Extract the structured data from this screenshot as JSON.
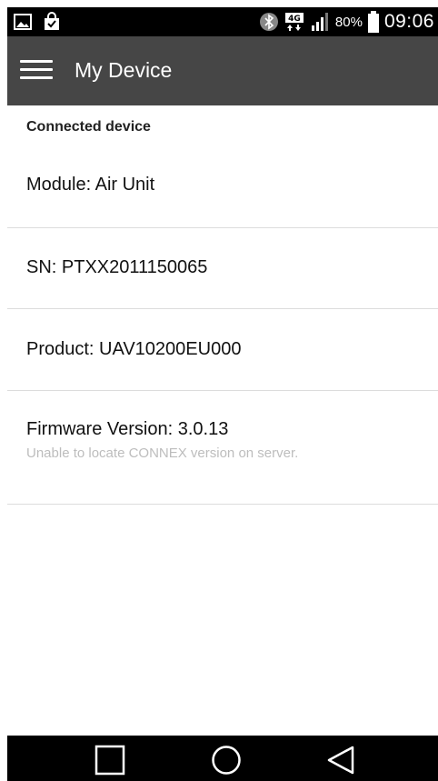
{
  "status_bar": {
    "left_icons": [
      "image-icon",
      "shopping-bag-icon"
    ],
    "right_icons": [
      "bluetooth-icon",
      "network-4g-icon",
      "signal-icon",
      "battery-icon"
    ],
    "network_label": "4G",
    "battery_percent": "80%",
    "time": "09:06"
  },
  "app_bar": {
    "title": "My Device",
    "menu_icon": "hamburger-menu-icon"
  },
  "content": {
    "section_header": "Connected device",
    "rows": [
      {
        "label": "Module: Air Unit"
      },
      {
        "label": "SN: PTXX2011150065"
      },
      {
        "label": "Product: UAV10200EU000"
      },
      {
        "label": "Firmware Version: 3.0.13",
        "subtext": "Unable to locate CONNEX version on server."
      }
    ]
  },
  "nav_bar": {
    "buttons": [
      "recent-apps-icon",
      "home-icon",
      "back-icon"
    ]
  },
  "colors": {
    "app_bar_bg": "#464646",
    "status_bar_bg": "#000000",
    "nav_bar_bg": "#000000",
    "divider": "#dcdcdc",
    "subtext": "#bdbdbd"
  }
}
